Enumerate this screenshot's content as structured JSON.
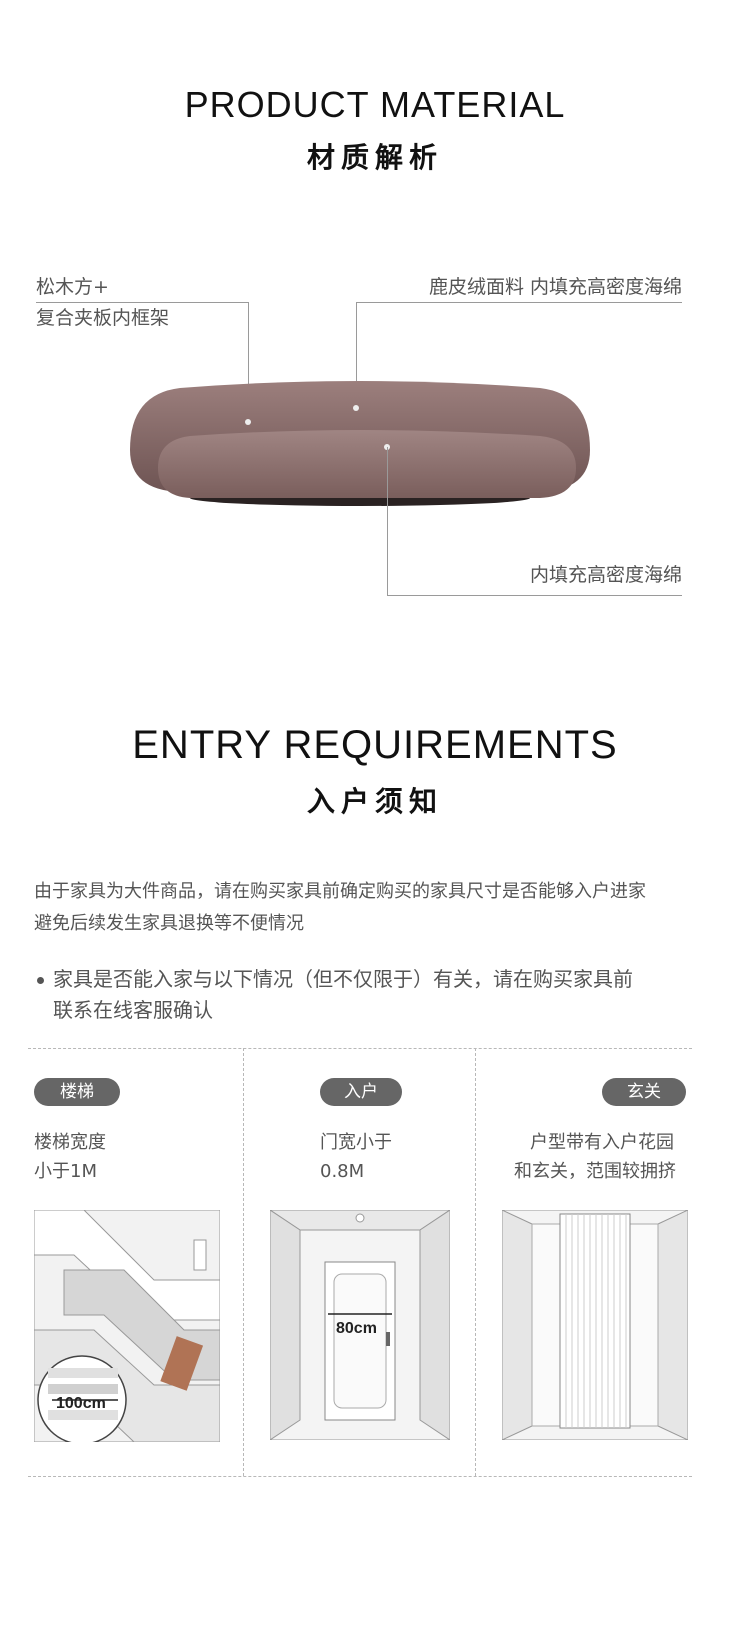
{
  "material": {
    "title_en": "PRODUCT MATERIAL",
    "title_cn": "材质解析",
    "callout_frame": [
      "松木方+",
      "复合夹板内框架"
    ],
    "callout_fabric": "鹿皮绒面料 内填充高密度海绵",
    "callout_cushion": "内填充高密度海绵"
  },
  "entry": {
    "title_en": "ENTRY REQUIREMENTS",
    "title_cn": "入户须知",
    "intro": [
      "由于家具为大件商品，请在购买家具前确定购买的家具尺寸是否能够入户进家",
      "避免后续发生家具退换等不便情况"
    ],
    "bullet": [
      "家具是否能入家与以下情况（但不仅限于）有关，请在购买家具前",
      "联系在线客服确认"
    ],
    "cards": [
      {
        "tag": "楼梯",
        "lines": [
          "楼梯宽度",
          "小于1M"
        ],
        "measure": "100cm"
      },
      {
        "tag": "入户",
        "lines": [
          "门宽小于",
          "0.8M"
        ],
        "measure": "80cm"
      },
      {
        "tag": "玄关",
        "lines": [
          "户型带有入户花园",
          "和玄关，范围较拥挤"
        ]
      }
    ]
  },
  "colors": {
    "sofa": "#8a6d6b",
    "pill": "#666666"
  }
}
